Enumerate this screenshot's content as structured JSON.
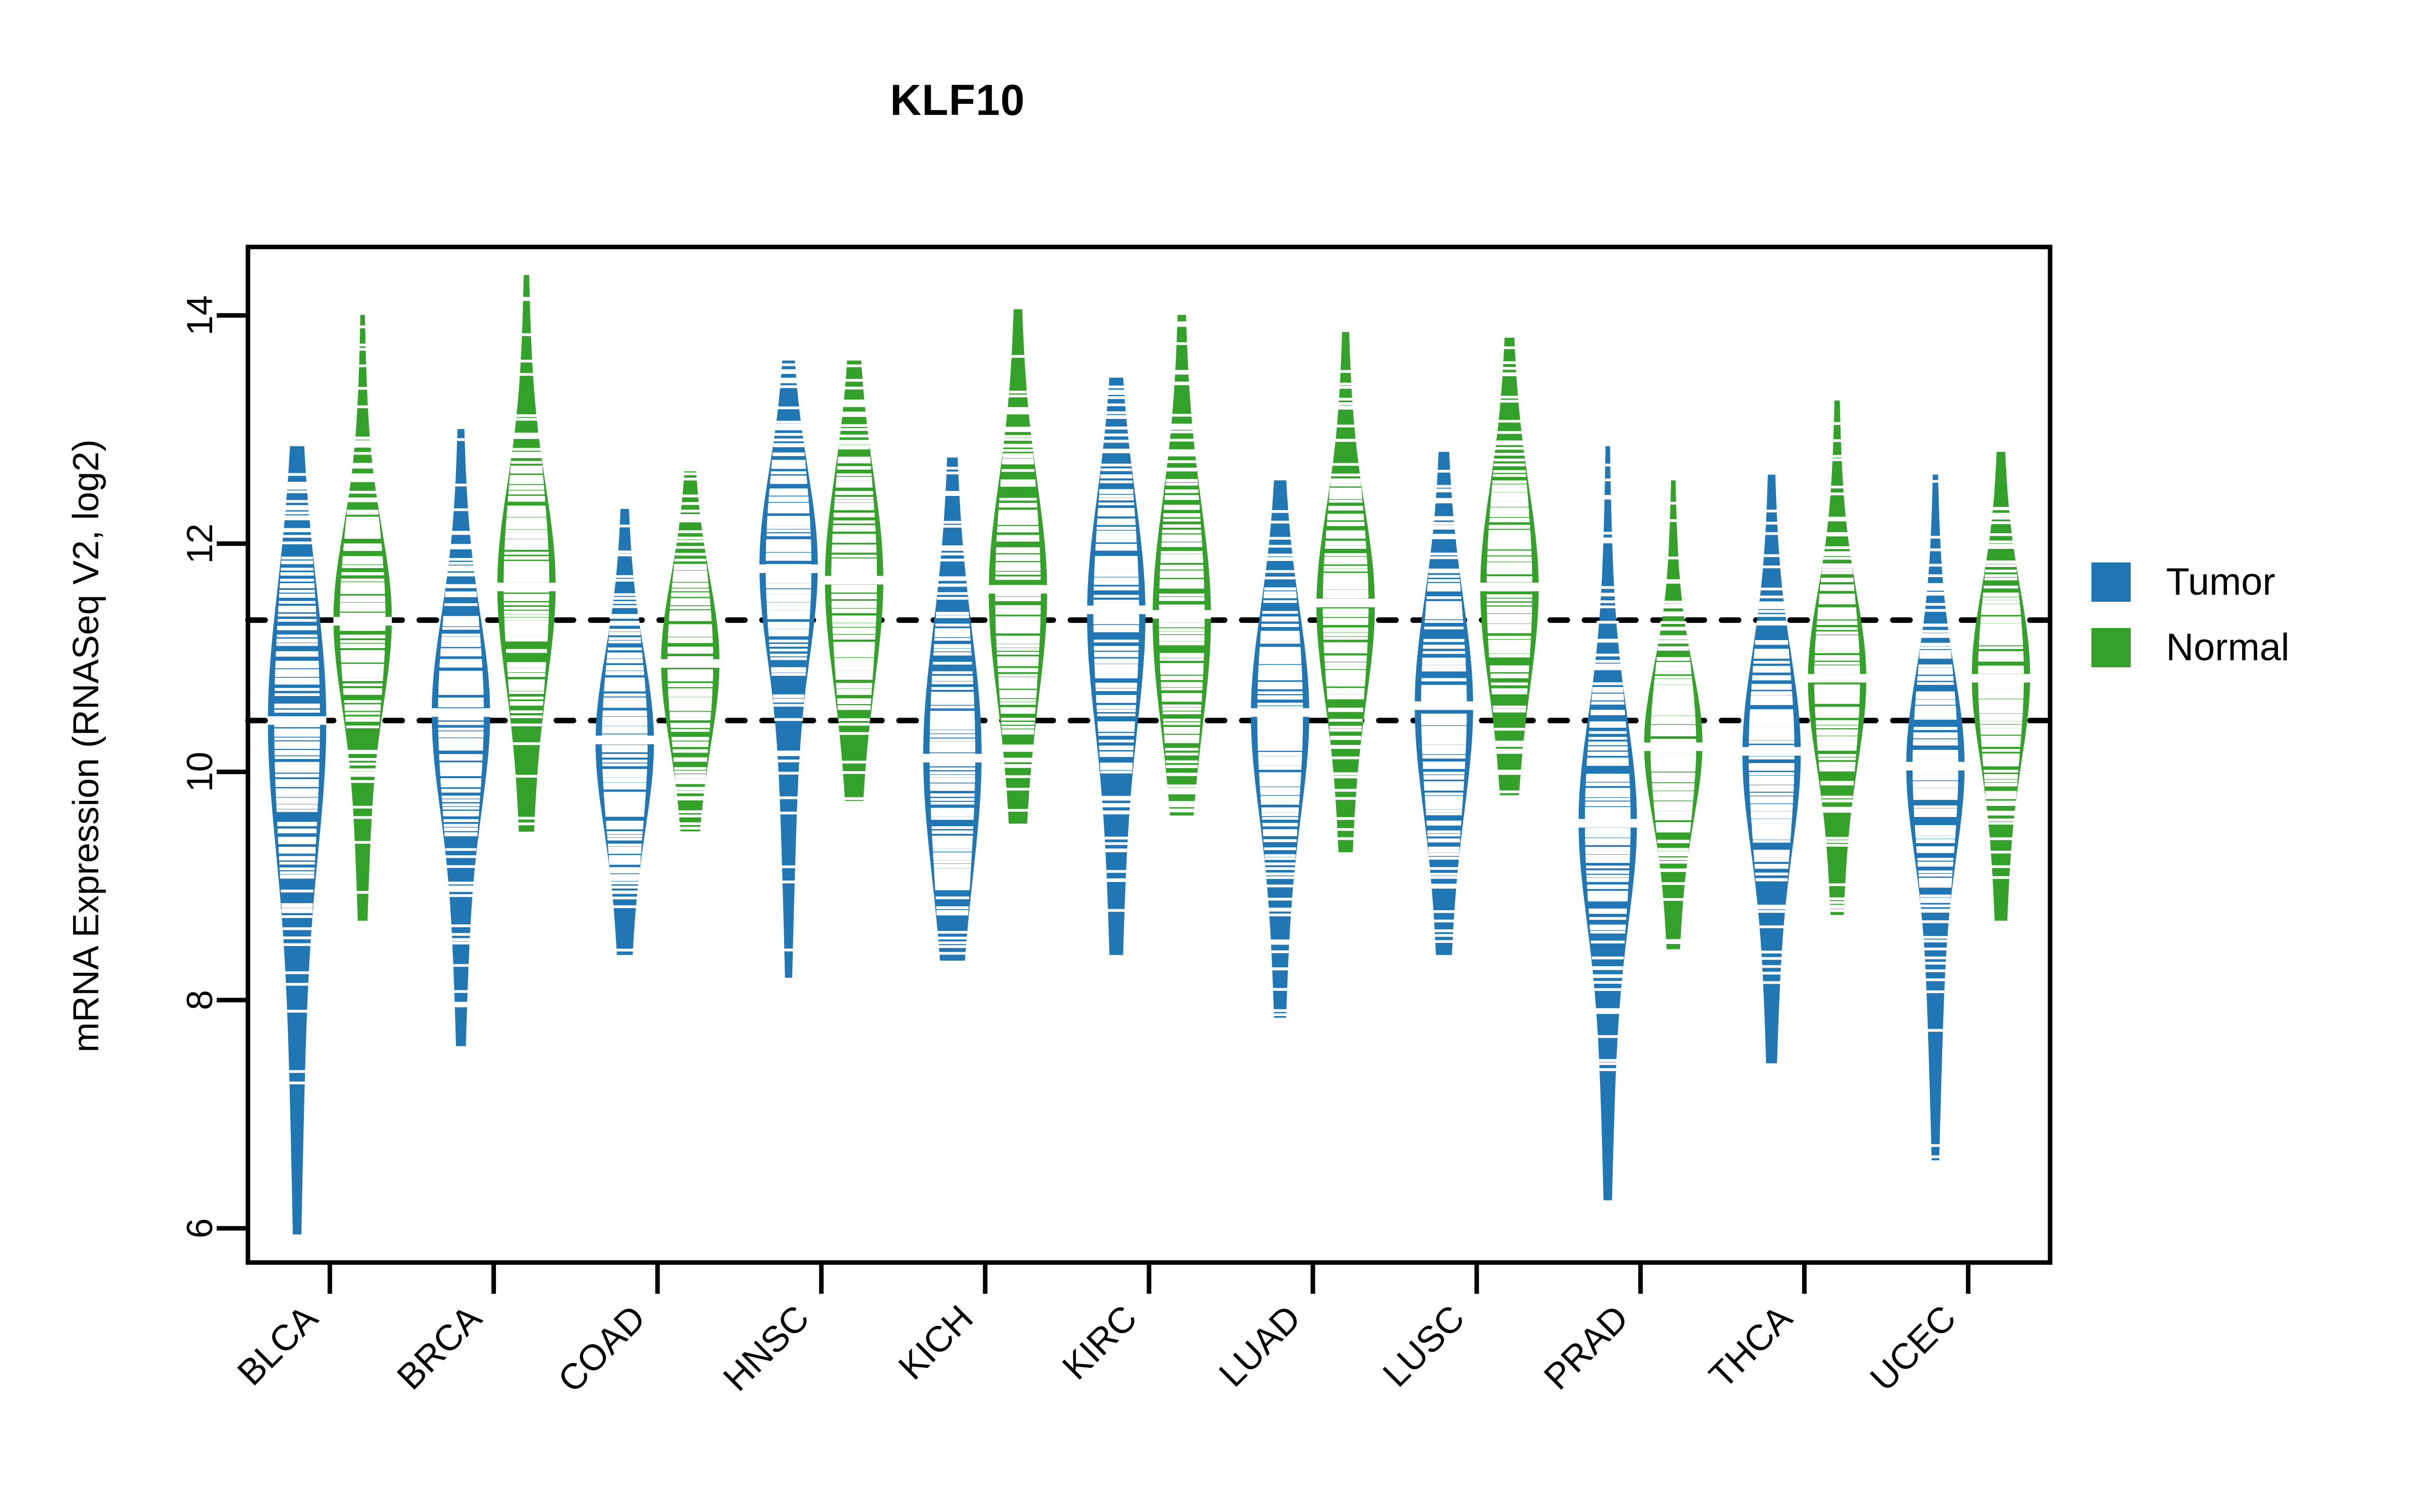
{
  "title": "KLF10",
  "axes": {
    "ylabel": "mRNA Expression (RNASeq V2, log2)",
    "yticks": [
      6,
      8,
      10,
      12,
      14
    ],
    "ylim": [
      5.7,
      14.6
    ],
    "xlabel": ""
  },
  "legend": {
    "position": "right",
    "items": [
      {
        "label": "Tumor",
        "color": "#2077b4",
        "key": "tumor"
      },
      {
        "label": "Normal",
        "color": "#34a12a",
        "key": "normal"
      }
    ]
  },
  "reference_lines": {
    "color": "#000000",
    "style": "dotted",
    "values": [
      11.33,
      10.45
    ]
  },
  "chart_data": {
    "type": "violin",
    "title": "KLF10",
    "xlabel": "",
    "ylabel": "mRNA Expression (RNASeq V2, log2)",
    "ylim": [
      5.7,
      14.6
    ],
    "grid": false,
    "legend_position": "right",
    "reference_lines": [
      11.33,
      10.45
    ],
    "categories": [
      "BLCA",
      "BRCA",
      "COAD",
      "HNSC",
      "KICH",
      "KIRC",
      "LUAD",
      "LUSC",
      "PRAD",
      "THCA",
      "UCEC"
    ],
    "series": [
      {
        "name": "Tumor",
        "color": "#2077b4",
        "groups": [
          {
            "category": "BLCA",
            "median": 10.45,
            "q1": 9.72,
            "q3": 11.05,
            "min": 5.95,
            "max": 12.85,
            "mode": 10.5,
            "spread": 1.1
          },
          {
            "category": "BRCA",
            "median": 10.52,
            "q1": 10.05,
            "q3": 11.05,
            "min": 7.6,
            "max": 13.0,
            "mode": 10.55,
            "spread": 0.8
          },
          {
            "category": "COAD",
            "median": 10.28,
            "q1": 9.72,
            "q3": 10.82,
            "min": 8.4,
            "max": 12.3,
            "mode": 10.3,
            "spread": 0.72
          },
          {
            "category": "HNSC",
            "median": 11.78,
            "q1": 11.2,
            "q3": 12.25,
            "min": 8.2,
            "max": 13.6,
            "mode": 11.85,
            "spread": 0.78
          },
          {
            "category": "KICH",
            "median": 10.12,
            "q1": 9.35,
            "q3": 11.05,
            "min": 8.35,
            "max": 12.75,
            "mode": 10.2,
            "spread": 1.0
          },
          {
            "category": "KIRC",
            "median": 11.42,
            "q1": 10.4,
            "q3": 11.95,
            "min": 8.4,
            "max": 13.45,
            "mode": 11.45,
            "spread": 0.95
          },
          {
            "category": "LUAD",
            "median": 10.52,
            "q1": 9.95,
            "q3": 11.2,
            "min": 7.85,
            "max": 12.55,
            "mode": 10.55,
            "spread": 0.85
          },
          {
            "category": "LUSC",
            "median": 10.58,
            "q1": 10.05,
            "q3": 11.2,
            "min": 8.4,
            "max": 12.8,
            "mode": 10.62,
            "spread": 0.86
          },
          {
            "category": "PRAD",
            "median": 9.55,
            "q1": 9.1,
            "q3": 10.35,
            "min": 6.25,
            "max": 12.85,
            "mode": 9.6,
            "spread": 0.85
          },
          {
            "category": "THCA",
            "median": 10.18,
            "q1": 9.55,
            "q3": 10.95,
            "min": 7.45,
            "max": 12.6,
            "mode": 10.2,
            "spread": 0.8
          },
          {
            "category": "UCEC",
            "median": 10.05,
            "q1": 9.4,
            "q3": 10.52,
            "min": 6.6,
            "max": 12.6,
            "mode": 10.1,
            "spread": 0.76
          }
        ]
      },
      {
        "name": "Normal",
        "color": "#34a12a",
        "groups": [
          {
            "category": "BLCA",
            "median": 11.32,
            "q1": 10.95,
            "q3": 11.78,
            "min": 8.7,
            "max": 14.0,
            "mode": 11.38,
            "spread": 0.72
          },
          {
            "category": "BRCA",
            "median": 11.62,
            "q1": 11.05,
            "q3": 12.18,
            "min": 9.48,
            "max": 14.35,
            "mode": 11.68,
            "spread": 0.8
          },
          {
            "category": "COAD",
            "median": 10.95,
            "q1": 10.48,
            "q3": 11.48,
            "min": 9.45,
            "max": 12.65,
            "mode": 11.0,
            "spread": 0.68
          },
          {
            "category": "HNSC",
            "median": 11.68,
            "q1": 11.15,
            "q3": 12.32,
            "min": 9.75,
            "max": 13.6,
            "mode": 11.72,
            "spread": 0.85
          },
          {
            "category": "KICH",
            "median": 11.6,
            "q1": 11.0,
            "q3": 12.15,
            "min": 9.55,
            "max": 14.05,
            "mode": 11.62,
            "spread": 0.88
          },
          {
            "category": "KIRC",
            "median": 11.38,
            "q1": 10.72,
            "q3": 12.05,
            "min": 9.6,
            "max": 14.0,
            "mode": 11.4,
            "spread": 0.92
          },
          {
            "category": "LUAD",
            "median": 11.48,
            "q1": 11.0,
            "q3": 11.95,
            "min": 9.3,
            "max": 13.85,
            "mode": 11.5,
            "spread": 0.78
          },
          {
            "category": "LUSC",
            "median": 11.62,
            "q1": 11.1,
            "q3": 12.18,
            "min": 9.8,
            "max": 13.8,
            "mode": 11.65,
            "spread": 0.82
          },
          {
            "category": "PRAD",
            "median": 10.22,
            "q1": 9.85,
            "q3": 10.7,
            "min": 8.45,
            "max": 12.55,
            "mode": 10.28,
            "spread": 0.62
          },
          {
            "category": "THCA",
            "median": 10.82,
            "q1": 10.4,
            "q3": 11.28,
            "min": 8.75,
            "max": 13.25,
            "mode": 10.85,
            "spread": 0.7
          },
          {
            "category": "UCEC",
            "median": 10.82,
            "q1": 10.4,
            "q3": 11.3,
            "min": 8.7,
            "max": 12.8,
            "mode": 10.88,
            "spread": 0.7
          }
        ]
      }
    ]
  }
}
